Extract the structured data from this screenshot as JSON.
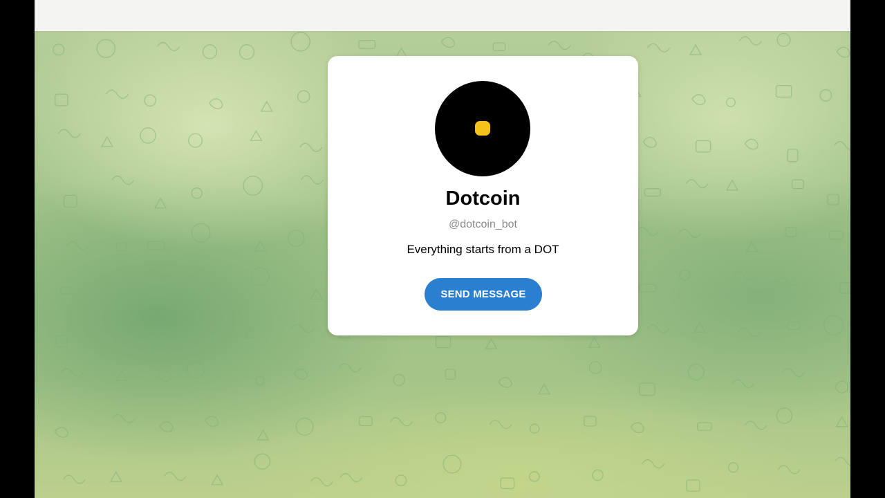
{
  "profile": {
    "name": "Dotcoin",
    "username": "@dotcoin_bot",
    "description": "Everything starts from a DOT",
    "send_label": "SEND MESSAGE",
    "avatar_icon": "dotcoin-logo-icon"
  },
  "colors": {
    "accent": "#2a7fd0",
    "avatar_bg": "#000000",
    "avatar_dot": "#f5c21a",
    "wallpaper": "#a8c78a",
    "pattern_stroke": "#7fae74"
  }
}
